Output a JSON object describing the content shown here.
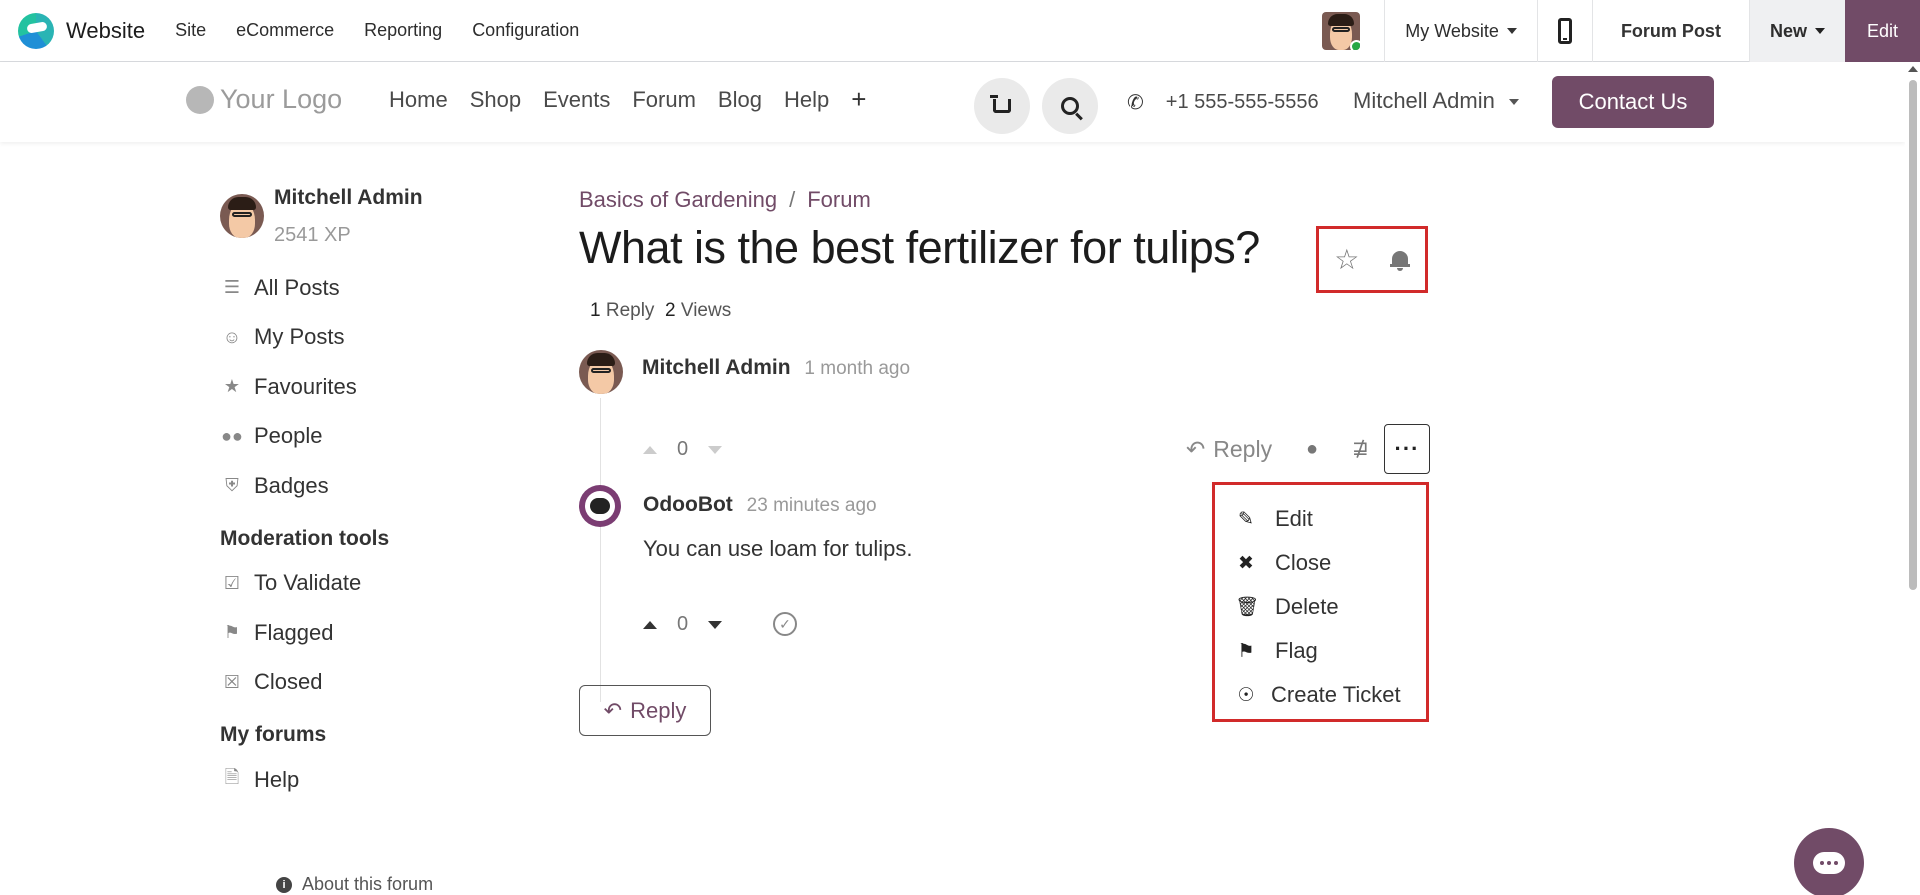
{
  "topbar": {
    "app_name": "Website",
    "menu": [
      "Site",
      "eCommerce",
      "Reporting",
      "Configuration"
    ],
    "website_selector": "My Website",
    "current_page": "Forum Post",
    "new_label": "New",
    "edit_label": "Edit"
  },
  "header": {
    "logo_text": "Your Logo",
    "nav": [
      "Home",
      "Shop",
      "Events",
      "Forum",
      "Blog",
      "Help",
      "+"
    ],
    "phone": "+1 555-555-5556",
    "user": "Mitchell Admin",
    "contact_label": "Contact Us"
  },
  "sidebar": {
    "user_name": "Mitchell Admin",
    "xp": "2541 XP",
    "items": [
      "All Posts",
      "My Posts",
      "Favourites",
      "People",
      "Badges"
    ],
    "moderation_heading": "Moderation tools",
    "moderation_items": [
      "To Validate",
      "Flagged",
      "Closed"
    ],
    "forums_heading": "My forums",
    "forums": [
      "Help"
    ],
    "about_label": "About this forum"
  },
  "post": {
    "breadcrumb": [
      "Basics of Gardening",
      "Forum"
    ],
    "title": "What is the best fertilizer for tulips?",
    "reply_count": "1",
    "reply_word": "Reply",
    "view_count": "2",
    "view_word": "Views",
    "author": "Mitchell Admin",
    "time": "1 month ago",
    "votes": "0",
    "reply_action": "Reply"
  },
  "menu": {
    "items": [
      "Edit",
      "Close",
      "Delete",
      "Flag",
      "Create Ticket"
    ]
  },
  "answer": {
    "author": "OdooBot",
    "time": "23 minutes ago",
    "body": "You can use loam for tulips.",
    "votes": "0"
  },
  "reply_button": "Reply",
  "colors": {
    "brand": "#714b67",
    "highlight": "#d12a2a"
  }
}
